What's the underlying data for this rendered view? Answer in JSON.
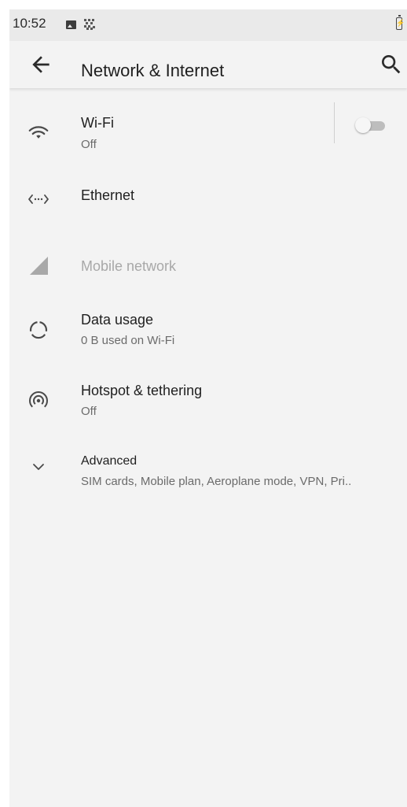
{
  "status_bar": {
    "time": "10:52",
    "icons": [
      "image-icon",
      "qr-icon",
      "battery-charging-icon"
    ]
  },
  "app_bar": {
    "title": "Network & Internet",
    "back_icon": "arrow-back-icon",
    "search_icon": "search-icon"
  },
  "items": [
    {
      "title": "Wi-Fi",
      "subtitle": "Off",
      "icon": "wifi-icon",
      "toggle": false
    },
    {
      "title": "Ethernet",
      "icon": "ethernet-icon"
    },
    {
      "title": "Mobile network",
      "icon": "cell-signal-icon",
      "disabled": true
    },
    {
      "title": "Data usage",
      "subtitle": "0 B used on Wi-Fi",
      "icon": "data-usage-icon"
    },
    {
      "title": "Hotspot & tethering",
      "subtitle": "Off",
      "icon": "hotspot-icon"
    },
    {
      "title": "Advanced",
      "subtitle": "SIM cards, Mobile plan, Aeroplane mode, VPN, Pri..",
      "icon": "chevron-down-icon"
    }
  ]
}
